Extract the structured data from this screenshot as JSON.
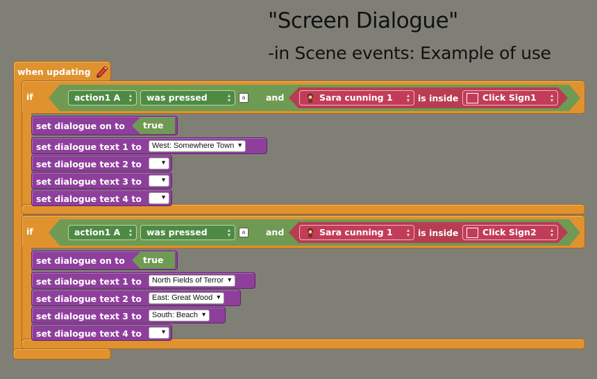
{
  "heading": {
    "title": "\"Screen Dialogue\"",
    "subtitle": "-in Scene events: Example of use"
  },
  "event": {
    "label": "when updating",
    "icon": "pen-icon"
  },
  "if_blocks": [
    {
      "if_label": "if",
      "control": "action1 A",
      "action": "was pressed",
      "key_icon": "a",
      "and_label": "and",
      "actor": "Sara cunning 1",
      "relation": "is inside",
      "region": "Click Sign1",
      "on_label": "set dialogue on to",
      "on_value": "true",
      "lines": [
        {
          "label": "set dialogue text 1 to",
          "value": "West: Somewhere Town"
        },
        {
          "label": "set dialogue text 2 to",
          "value": ""
        },
        {
          "label": "set dialogue text 3 to",
          "value": ""
        },
        {
          "label": "set dialogue text 4 to",
          "value": ""
        }
      ]
    },
    {
      "if_label": "if",
      "control": "action1 A",
      "action": "was pressed",
      "key_icon": "a",
      "and_label": "and",
      "actor": "Sara cunning 1",
      "relation": "is inside",
      "region": "Click Sign2",
      "on_label": "set dialogue on to",
      "on_value": "true",
      "lines": [
        {
          "label": "set dialogue text 1 to",
          "value": "North Fields of Terror"
        },
        {
          "label": "set dialogue text 2 to",
          "value": "East: Great Wood"
        },
        {
          "label": "set dialogue text 3 to",
          "value": "South: Beach"
        },
        {
          "label": "set dialogue text 4 to",
          "value": ""
        }
      ]
    }
  ],
  "colors": {
    "background": "#807f76",
    "event_block": "#e0922f",
    "action_block": "#8e3f9c",
    "condition": "#6f9a53",
    "actor_block": "#c23c58"
  }
}
